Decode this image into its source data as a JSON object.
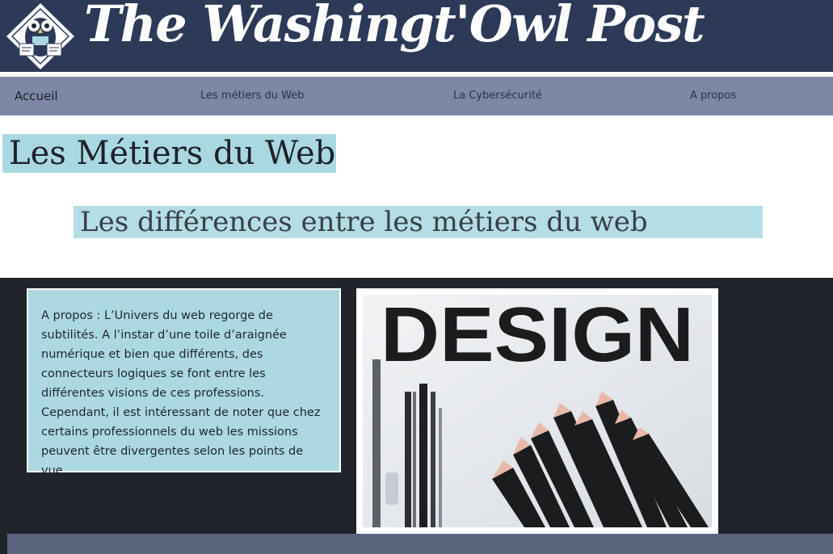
{
  "header": {
    "site_title": "The Washingt'Owl Post",
    "logo_text": "Owl Post",
    "colors": {
      "header_bg": "#2c3a57",
      "nav_bg": "#7c88a4",
      "heading_bg": "#a9d8e2",
      "content_bg": "#20242b",
      "footer_bg": "#59637c"
    }
  },
  "nav": {
    "items": [
      {
        "label": "Accueil"
      },
      {
        "label": "Les métiers du Web"
      },
      {
        "label": "La Cybersécurité"
      },
      {
        "label": "A propos"
      }
    ]
  },
  "main": {
    "title": "Les Métiers du Web",
    "subtitle": "Les différences entre les métiers du web",
    "about_text": "A propos : L’Univers du web regorge de subtilités. A l’instar d’une toile d’araignée numérique et bien que différents, des connecteurs logiques se font entre les différentes visions de ces professions. Cependant, il est intéressant de noter que chez certains professionnels du web les missions peuvent être divergentes selon les points de vue.",
    "image_word": "DESIGN"
  }
}
